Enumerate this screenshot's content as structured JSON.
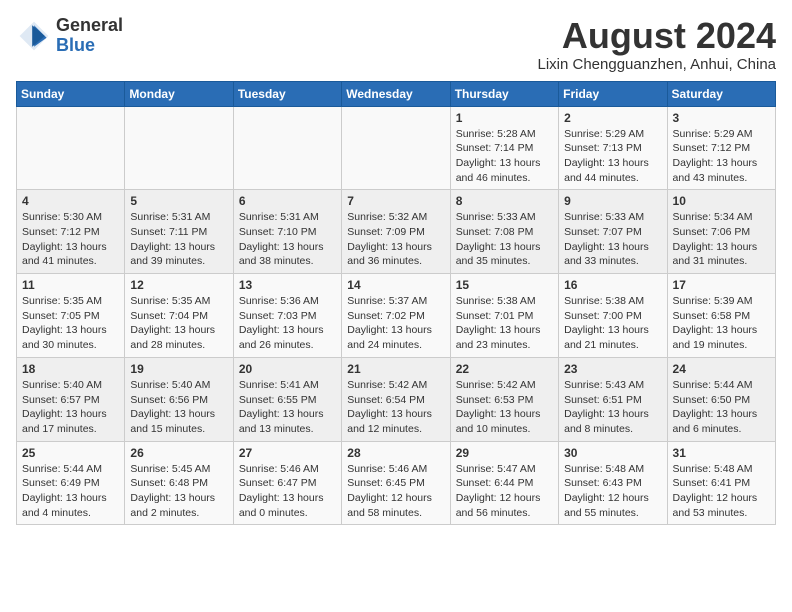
{
  "logo": {
    "general": "General",
    "blue": "Blue"
  },
  "title": "August 2024",
  "subtitle": "Lixin Chengguanzhen, Anhui, China",
  "weekdays": [
    "Sunday",
    "Monday",
    "Tuesday",
    "Wednesday",
    "Thursday",
    "Friday",
    "Saturday"
  ],
  "weeks": [
    [
      {
        "day": "",
        "info": ""
      },
      {
        "day": "",
        "info": ""
      },
      {
        "day": "",
        "info": ""
      },
      {
        "day": "",
        "info": ""
      },
      {
        "day": "1",
        "info": "Sunrise: 5:28 AM\nSunset: 7:14 PM\nDaylight: 13 hours\nand 46 minutes."
      },
      {
        "day": "2",
        "info": "Sunrise: 5:29 AM\nSunset: 7:13 PM\nDaylight: 13 hours\nand 44 minutes."
      },
      {
        "day": "3",
        "info": "Sunrise: 5:29 AM\nSunset: 7:12 PM\nDaylight: 13 hours\nand 43 minutes."
      }
    ],
    [
      {
        "day": "4",
        "info": "Sunrise: 5:30 AM\nSunset: 7:12 PM\nDaylight: 13 hours\nand 41 minutes."
      },
      {
        "day": "5",
        "info": "Sunrise: 5:31 AM\nSunset: 7:11 PM\nDaylight: 13 hours\nand 39 minutes."
      },
      {
        "day": "6",
        "info": "Sunrise: 5:31 AM\nSunset: 7:10 PM\nDaylight: 13 hours\nand 38 minutes."
      },
      {
        "day": "7",
        "info": "Sunrise: 5:32 AM\nSunset: 7:09 PM\nDaylight: 13 hours\nand 36 minutes."
      },
      {
        "day": "8",
        "info": "Sunrise: 5:33 AM\nSunset: 7:08 PM\nDaylight: 13 hours\nand 35 minutes."
      },
      {
        "day": "9",
        "info": "Sunrise: 5:33 AM\nSunset: 7:07 PM\nDaylight: 13 hours\nand 33 minutes."
      },
      {
        "day": "10",
        "info": "Sunrise: 5:34 AM\nSunset: 7:06 PM\nDaylight: 13 hours\nand 31 minutes."
      }
    ],
    [
      {
        "day": "11",
        "info": "Sunrise: 5:35 AM\nSunset: 7:05 PM\nDaylight: 13 hours\nand 30 minutes."
      },
      {
        "day": "12",
        "info": "Sunrise: 5:35 AM\nSunset: 7:04 PM\nDaylight: 13 hours\nand 28 minutes."
      },
      {
        "day": "13",
        "info": "Sunrise: 5:36 AM\nSunset: 7:03 PM\nDaylight: 13 hours\nand 26 minutes."
      },
      {
        "day": "14",
        "info": "Sunrise: 5:37 AM\nSunset: 7:02 PM\nDaylight: 13 hours\nand 24 minutes."
      },
      {
        "day": "15",
        "info": "Sunrise: 5:38 AM\nSunset: 7:01 PM\nDaylight: 13 hours\nand 23 minutes."
      },
      {
        "day": "16",
        "info": "Sunrise: 5:38 AM\nSunset: 7:00 PM\nDaylight: 13 hours\nand 21 minutes."
      },
      {
        "day": "17",
        "info": "Sunrise: 5:39 AM\nSunset: 6:58 PM\nDaylight: 13 hours\nand 19 minutes."
      }
    ],
    [
      {
        "day": "18",
        "info": "Sunrise: 5:40 AM\nSunset: 6:57 PM\nDaylight: 13 hours\nand 17 minutes."
      },
      {
        "day": "19",
        "info": "Sunrise: 5:40 AM\nSunset: 6:56 PM\nDaylight: 13 hours\nand 15 minutes."
      },
      {
        "day": "20",
        "info": "Sunrise: 5:41 AM\nSunset: 6:55 PM\nDaylight: 13 hours\nand 13 minutes."
      },
      {
        "day": "21",
        "info": "Sunrise: 5:42 AM\nSunset: 6:54 PM\nDaylight: 13 hours\nand 12 minutes."
      },
      {
        "day": "22",
        "info": "Sunrise: 5:42 AM\nSunset: 6:53 PM\nDaylight: 13 hours\nand 10 minutes."
      },
      {
        "day": "23",
        "info": "Sunrise: 5:43 AM\nSunset: 6:51 PM\nDaylight: 13 hours\nand 8 minutes."
      },
      {
        "day": "24",
        "info": "Sunrise: 5:44 AM\nSunset: 6:50 PM\nDaylight: 13 hours\nand 6 minutes."
      }
    ],
    [
      {
        "day": "25",
        "info": "Sunrise: 5:44 AM\nSunset: 6:49 PM\nDaylight: 13 hours\nand 4 minutes."
      },
      {
        "day": "26",
        "info": "Sunrise: 5:45 AM\nSunset: 6:48 PM\nDaylight: 13 hours\nand 2 minutes."
      },
      {
        "day": "27",
        "info": "Sunrise: 5:46 AM\nSunset: 6:47 PM\nDaylight: 13 hours\nand 0 minutes."
      },
      {
        "day": "28",
        "info": "Sunrise: 5:46 AM\nSunset: 6:45 PM\nDaylight: 12 hours\nand 58 minutes."
      },
      {
        "day": "29",
        "info": "Sunrise: 5:47 AM\nSunset: 6:44 PM\nDaylight: 12 hours\nand 56 minutes."
      },
      {
        "day": "30",
        "info": "Sunrise: 5:48 AM\nSunset: 6:43 PM\nDaylight: 12 hours\nand 55 minutes."
      },
      {
        "day": "31",
        "info": "Sunrise: 5:48 AM\nSunset: 6:41 PM\nDaylight: 12 hours\nand 53 minutes."
      }
    ]
  ]
}
